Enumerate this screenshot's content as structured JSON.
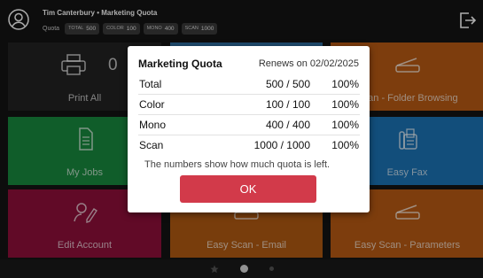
{
  "header": {
    "user_line": "Tim Canterbury • Marketing Quota",
    "quota_label": "Quota",
    "chips": [
      {
        "key": "TOTAL",
        "value": "500"
      },
      {
        "key": "COLOR",
        "value": "100"
      },
      {
        "key": "MONO",
        "value": "400"
      },
      {
        "key": "SCAN",
        "value": "1000"
      }
    ]
  },
  "tiles": {
    "print_all": "Print All",
    "print_count": "0",
    "scan_folder": "Scan - Folder Browsing",
    "my_jobs": "My Jobs",
    "easy_fax": "Easy Fax",
    "edit_account": "Edit Account",
    "easy_scan_email": "Easy Scan - Email",
    "easy_scan_params": "Easy Scan - Parameters"
  },
  "dialog": {
    "title": "Marketing Quota",
    "renews": "Renews on 02/02/2025",
    "rows": [
      {
        "name": "Total",
        "value": "500 / 500",
        "percent": "100%"
      },
      {
        "name": "Color",
        "value": "100 / 100",
        "percent": "100%"
      },
      {
        "name": "Mono",
        "value": "400 / 400",
        "percent": "100%"
      },
      {
        "name": "Scan",
        "value": "1000 / 1000",
        "percent": "100%"
      }
    ],
    "note": "The numbers show how much quota is left.",
    "ok_label": "OK"
  },
  "pager": {
    "page_count": 3,
    "current": 2
  },
  "colors": {
    "ok_button": "#d23a4a",
    "print_tile": "#222222",
    "myjobs_tile": "#188a3e",
    "account_tile": "#8f0f3a",
    "scan_tile": "#b85a14",
    "fax_tile": "#1b74b5"
  }
}
